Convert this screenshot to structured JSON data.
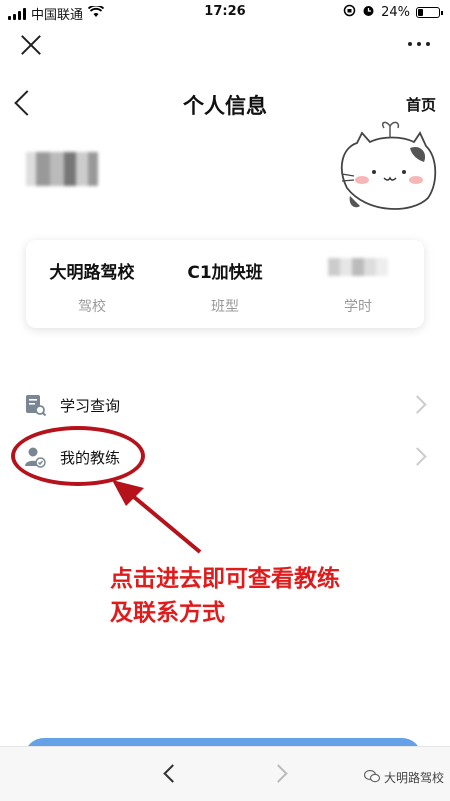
{
  "status": {
    "carrier": "中国联通",
    "time": "17:26",
    "battery": "24%",
    "battery_level": 0.24
  },
  "header": {
    "title": "个人信息",
    "home": "首页"
  },
  "card": {
    "school": {
      "value": "大明路驾校",
      "label": "驾校"
    },
    "class_type": {
      "value": "C1加快班",
      "label": "班型"
    },
    "hours": {
      "label": "学时"
    }
  },
  "menu": {
    "items": [
      {
        "label": "学习查询",
        "icon": "document-search-icon"
      },
      {
        "label": "我的教练",
        "icon": "coach-user-icon"
      }
    ]
  },
  "annotation": {
    "line1": "点击进去即可查看教练",
    "line2": "及联系方式"
  },
  "watermark": {
    "text": "大明路驾校"
  },
  "colors": {
    "annotation_red": "#e01b1b",
    "ellipse_red": "#b5121b",
    "accent_blue": "#4a90e2"
  }
}
